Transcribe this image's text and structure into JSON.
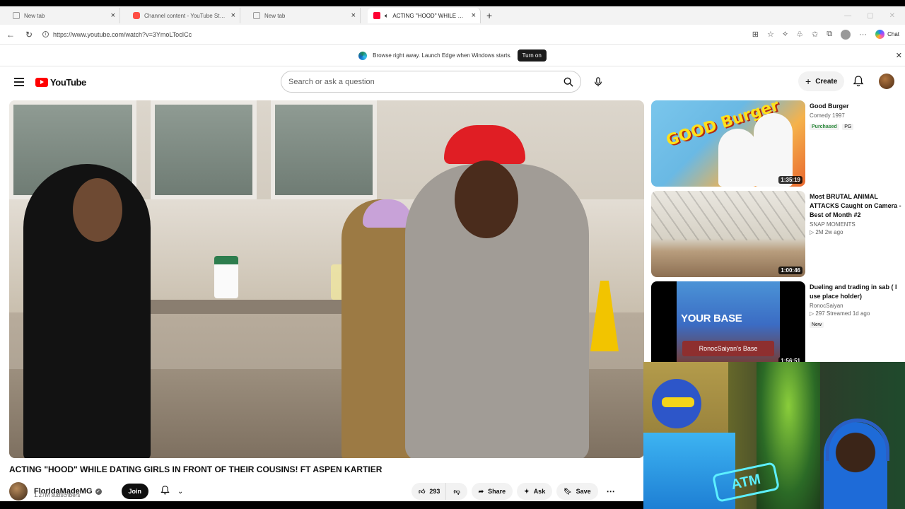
{
  "browser": {
    "tabs": [
      {
        "label": "New tab",
        "active": false,
        "favicon": "page-icon"
      },
      {
        "label": "Channel content - YouTube Studio",
        "active": false,
        "favicon": "youtube-studio-icon"
      },
      {
        "label": "New tab",
        "active": false,
        "favicon": "page-icon"
      },
      {
        "label": "ACTING \"HOOD\" WHILE DATI",
        "active": true,
        "favicon": "youtube-icon"
      }
    ],
    "url": "https://www.youtube.com/watch?v=3YmoLTocICc",
    "copilot_label": "Chat"
  },
  "infobar": {
    "message": "Browse right away. Launch Edge when Windows starts.",
    "button": "Turn on"
  },
  "youtube": {
    "logo_text": "YouTube",
    "search_placeholder": "Search or ask a question",
    "create_label": "Create"
  },
  "video": {
    "title": "ACTING \"HOOD\" WHILE DATING GIRLS IN FRONT OF THEIR COUSINS! FT ASPEN KARTIER",
    "channel": "FloridaMadeMG",
    "subscribers": "1.27M subscribers",
    "join_label": "Join",
    "likes": "293",
    "share_label": "Share",
    "ask_label": "Ask",
    "save_label": "Save"
  },
  "recommendations": [
    {
      "title": "Good Burger",
      "channel": "Comedy 1997",
      "badge1": "Purchased",
      "badge2": "PG",
      "duration": "1:35:19"
    },
    {
      "title": "Most BRUTAL ANIMAL ATTACKS Caught on Camera - Best of Month #2",
      "channel": "SNAP MOMENTS",
      "stats": "▷ 2M  2w ago",
      "duration": "1:00:46"
    },
    {
      "title": "Dueling and trading in sab ( I use place holder)",
      "channel": "RonocSaiyan",
      "stats": "▷ 297  Streamed 1d ago",
      "badge1": "New",
      "duration": "1:56:51",
      "thumb_text1": "YOUR BASE",
      "thumb_text2": "RonocSaiyan's Base"
    }
  ],
  "thumbnail_text": {
    "good_burger": "GOOD Burger"
  },
  "webcam": {
    "sign_text": "ATM"
  },
  "colors": {
    "youtube_red": "#ff0000",
    "accent_green": "#2c8a3c"
  }
}
